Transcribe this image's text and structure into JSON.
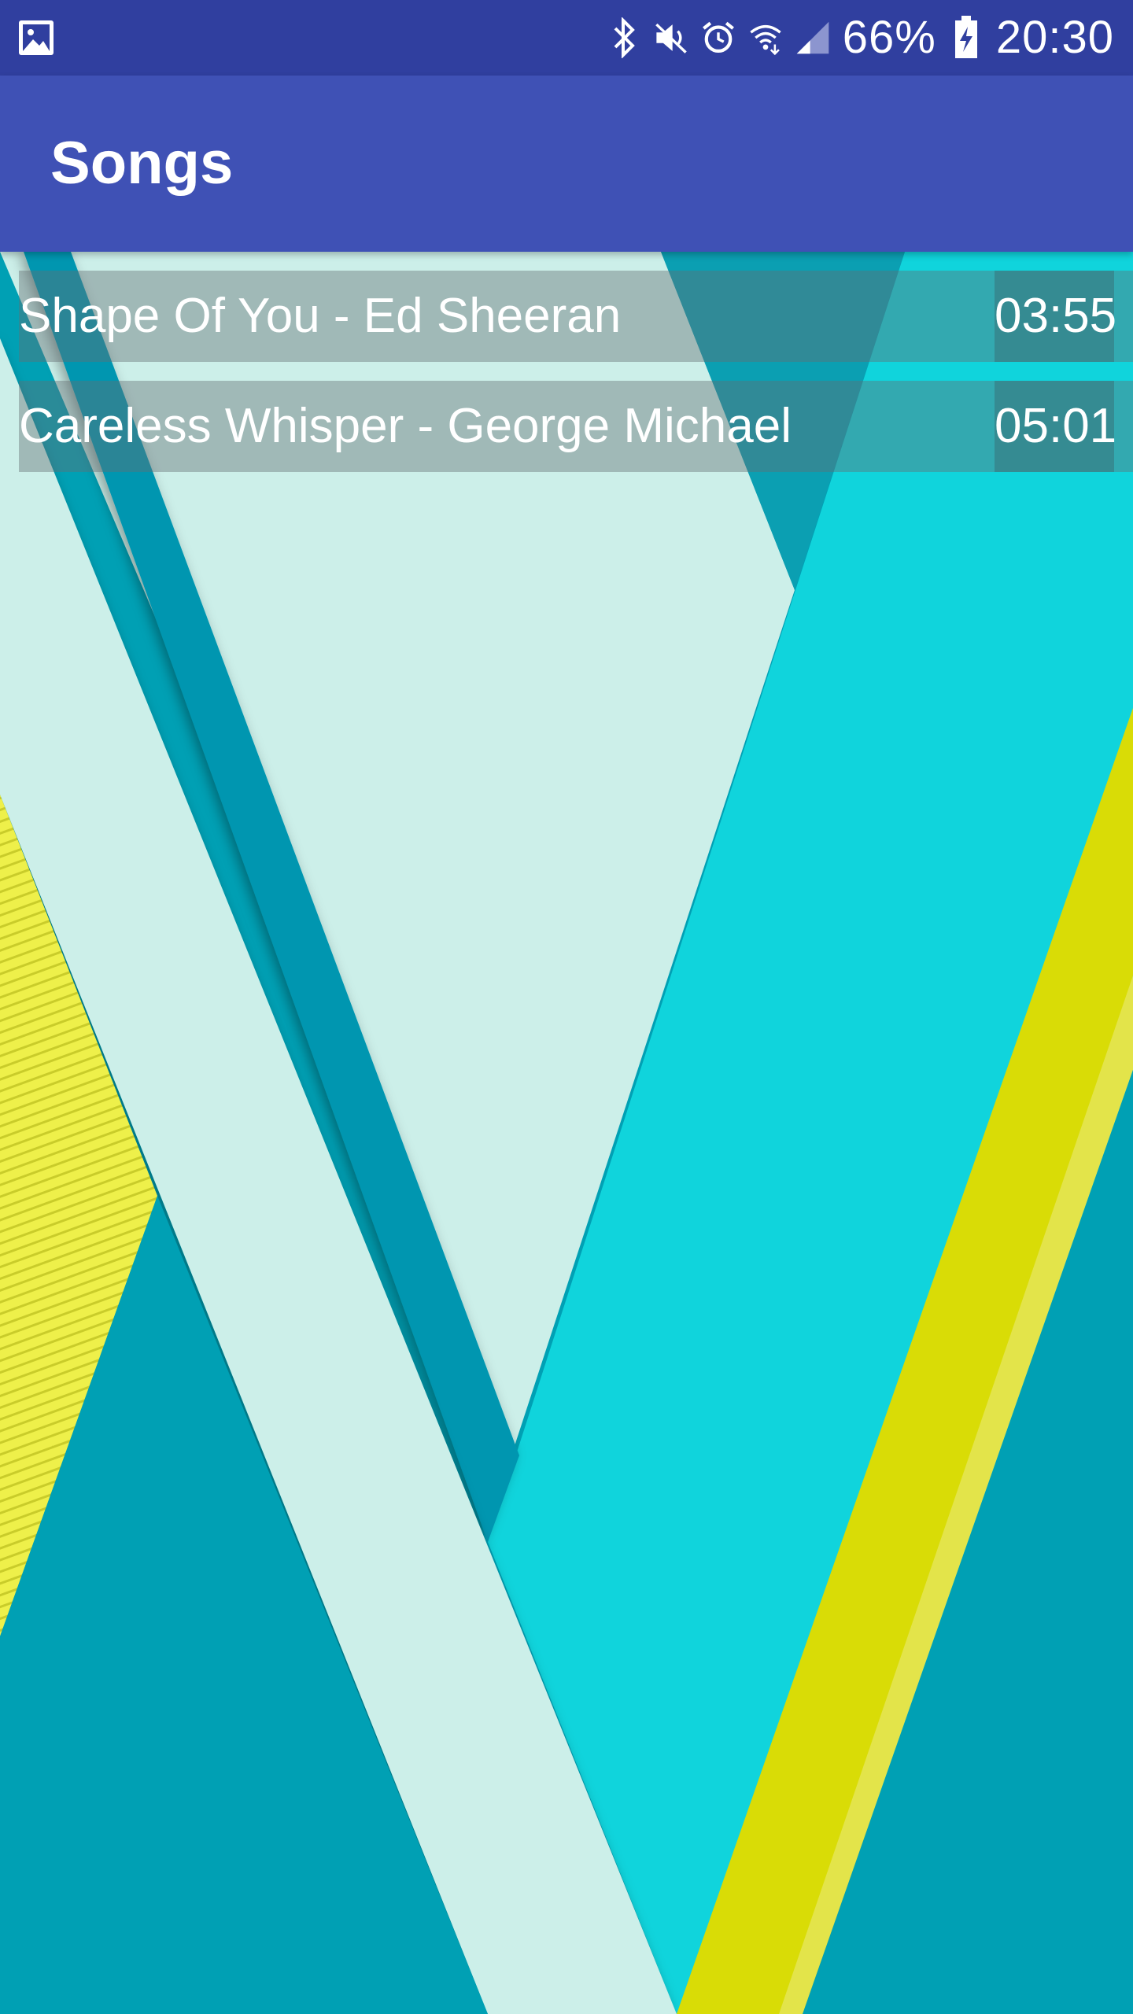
{
  "status_bar": {
    "notification_icon": "gallery-icon",
    "icons": [
      "bluetooth-icon",
      "mute-icon",
      "alarm-icon",
      "wifi-icon",
      "signal-icon",
      "battery-charging-icon"
    ],
    "battery": "66%",
    "time": "20:30"
  },
  "app_bar": {
    "title": "Songs"
  },
  "songs": [
    {
      "title": "Shape Of You - Ed Sheeran",
      "duration": "03:55"
    },
    {
      "title": "Careless Whisper - George Michael",
      "duration": "05:01"
    }
  ],
  "colors": {
    "status_bar": "#303f9f",
    "app_bar": "#3f51b5",
    "wallpaper_teal": "#00a0b4",
    "wallpaper_cyan": "#10d4dc",
    "wallpaper_mint": "#ccefe9",
    "wallpaper_yellow": "#d9dc06"
  }
}
